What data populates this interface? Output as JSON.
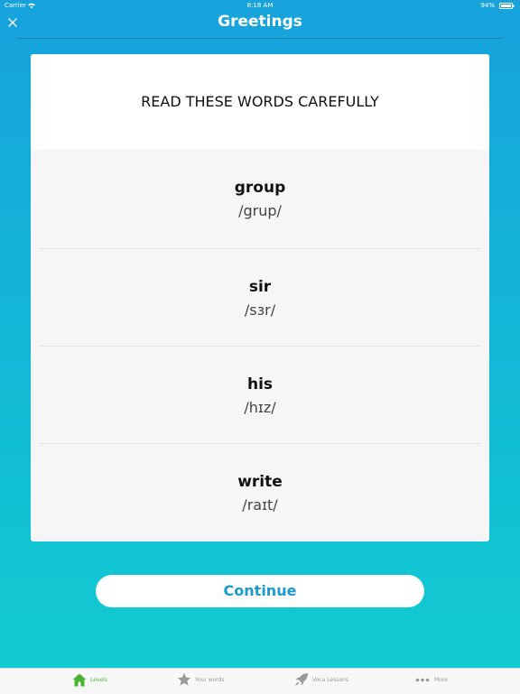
{
  "status_bar": {
    "carrier": "Carrier",
    "time": "8:18 AM",
    "battery": "94%"
  },
  "nav": {
    "title": "Greetings",
    "close_icon": "close-icon"
  },
  "card": {
    "title": "READ THESE WORDS CAREFULLY",
    "words": [
      {
        "word": "group",
        "phonetic": "/grup/"
      },
      {
        "word": "sir",
        "phonetic": "/sɜr/"
      },
      {
        "word": "his",
        "phonetic": "/hɪz/"
      },
      {
        "word": "write",
        "phonetic": "/raɪt/"
      }
    ]
  },
  "continue_label": "Continue",
  "tabs": [
    {
      "label": "Levels",
      "icon": "home-icon",
      "active": true
    },
    {
      "label": "Your words",
      "icon": "star-icon",
      "active": false
    },
    {
      "label": "Voca Lessons",
      "icon": "rocket-icon",
      "active": false
    },
    {
      "label": "More",
      "icon": "more-dots-icon",
      "active": false
    }
  ],
  "colors": {
    "accent": "#1a9bd2",
    "active_tab": "#47b52f",
    "bg_top": "#17a2dc",
    "bg_bottom": "#11ccd0"
  }
}
